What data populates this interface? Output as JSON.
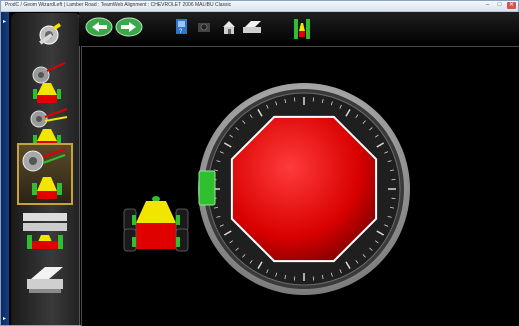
{
  "window": {
    "title": "ProdC / Geom WizardLeft | Lamber Road : TeamWeb Alignment : CHEVROLET 2006 MALIBU Classic",
    "minimize_label": "–",
    "maximize_label": "□",
    "close_label": "✕"
  },
  "toolbar": {
    "back_label": "back",
    "next_label": "next",
    "icons": [
      "help-icon",
      "camera-icon",
      "home-icon",
      "print-icon",
      "vehicle-level-icon"
    ]
  },
  "sidebar": {
    "items": [
      {
        "name": "wrench-adjust-icon"
      },
      {
        "name": "wheel-runout-icon"
      },
      {
        "name": "caster-sweep-icon"
      },
      {
        "name": "wheel-adjust-active-icon"
      },
      {
        "name": "measurement-grid-icon"
      },
      {
        "name": "printer-report-icon"
      }
    ]
  },
  "gauge": {
    "status": "out-of-tolerance",
    "indicator_color": "#e00000",
    "marker_color": "#2fbf2f"
  },
  "colors": {
    "accent_red": "#e00000",
    "accent_green": "#2fbf2f",
    "accent_yellow": "#f2e600",
    "active_border": "#c9a23a"
  }
}
